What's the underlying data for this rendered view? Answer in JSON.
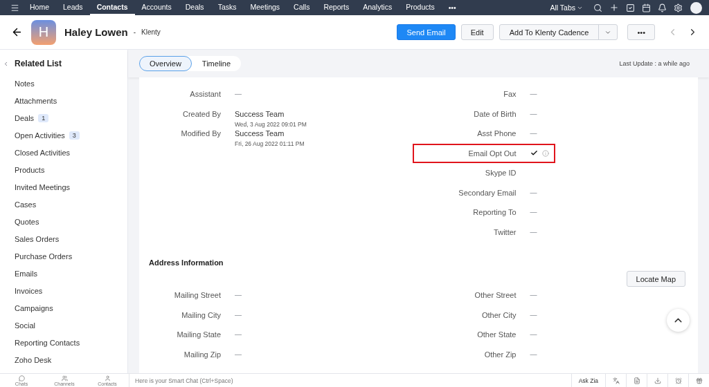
{
  "nav": {
    "items": [
      {
        "label": "Home",
        "selected": false
      },
      {
        "label": "Leads",
        "selected": false
      },
      {
        "label": "Contacts",
        "selected": true
      },
      {
        "label": "Accounts",
        "selected": false
      },
      {
        "label": "Deals",
        "selected": false
      },
      {
        "label": "Tasks",
        "selected": false
      },
      {
        "label": "Meetings",
        "selected": false
      },
      {
        "label": "Calls",
        "selected": false
      },
      {
        "label": "Reports",
        "selected": false
      },
      {
        "label": "Analytics",
        "selected": false
      },
      {
        "label": "Products",
        "selected": false
      }
    ],
    "more": "•••",
    "all_tabs": "All Tabs"
  },
  "record": {
    "avatar_letter": "H",
    "name": "Haley Lowen",
    "separator": "-",
    "account": "Klenty",
    "buttons": [
      {
        "label": "Send Email",
        "kind": "primary"
      },
      {
        "label": "Edit",
        "kind": "plain"
      },
      {
        "label": "Add To Klenty Cadence",
        "kind": "split"
      },
      {
        "label": "•••",
        "kind": "plain"
      }
    ]
  },
  "sidebar": {
    "title": "Related List",
    "items": [
      {
        "label": "Notes"
      },
      {
        "label": "Attachments"
      },
      {
        "label": "Deals",
        "count": "1"
      },
      {
        "label": "Open Activities",
        "count": "3"
      },
      {
        "label": "Closed Activities"
      },
      {
        "label": "Products"
      },
      {
        "label": "Invited Meetings"
      },
      {
        "label": "Cases"
      },
      {
        "label": "Quotes"
      },
      {
        "label": "Sales Orders"
      },
      {
        "label": "Purchase Orders"
      },
      {
        "label": "Emails"
      },
      {
        "label": "Invoices"
      },
      {
        "label": "Campaigns"
      },
      {
        "label": "Social"
      },
      {
        "label": "Reporting Contacts"
      },
      {
        "label": "Zoho Desk"
      }
    ]
  },
  "tabs": [
    {
      "label": "Overview",
      "selected": true
    },
    {
      "label": "Timeline",
      "selected": false
    }
  ],
  "last_update": "Last Update : a while ago",
  "details": {
    "left": [
      {
        "label": "Assistant",
        "kind": "text",
        "value": "—"
      },
      {
        "label": "Created By",
        "kind": "text",
        "value": "Success Team",
        "sub": "Wed, 3 Aug 2022 09:01 PM"
      },
      {
        "label": "Modified By",
        "kind": "text",
        "value": "Success Team",
        "sub": "Fri, 26 Aug 2022 01:11 PM"
      }
    ],
    "right": [
      {
        "label": "Fax",
        "kind": "text",
        "value": "—"
      },
      {
        "label": "Date of Birth",
        "kind": "text",
        "value": "—"
      },
      {
        "label": "Asst Phone",
        "kind": "text",
        "value": "—"
      },
      {
        "label": "Email Opt Out",
        "kind": "checkbox",
        "checked": true,
        "highlighted": true
      },
      {
        "label": "Skype ID",
        "kind": "text"
      },
      {
        "label": "Secondary Email",
        "kind": "text",
        "value": "—"
      },
      {
        "label": "Reporting To",
        "kind": "text",
        "value": "—"
      },
      {
        "label": "Twitter",
        "kind": "text",
        "value": "—"
      }
    ]
  },
  "address": {
    "title": "Address Information",
    "button": "Locate Map",
    "left": [
      {
        "label": "Mailing Street",
        "value": "—"
      },
      {
        "label": "Mailing City",
        "value": "—"
      },
      {
        "label": "Mailing State",
        "value": "—"
      },
      {
        "label": "Mailing Zip",
        "value": "—"
      }
    ],
    "right": [
      {
        "label": "Other Street",
        "value": "—"
      },
      {
        "label": "Other City",
        "value": "—"
      },
      {
        "label": "Other State",
        "value": "—"
      },
      {
        "label": "Other Zip",
        "value": "—"
      }
    ]
  },
  "bottom": {
    "apps": [
      {
        "label": "Chats",
        "kind": "chat"
      },
      {
        "label": "Channels",
        "kind": "channels"
      },
      {
        "label": "Contacts",
        "kind": "contact"
      }
    ],
    "chat_placeholder": "Here is your Smart Chat (Ctrl+Space)",
    "ask_zia": "Ask Zia"
  }
}
